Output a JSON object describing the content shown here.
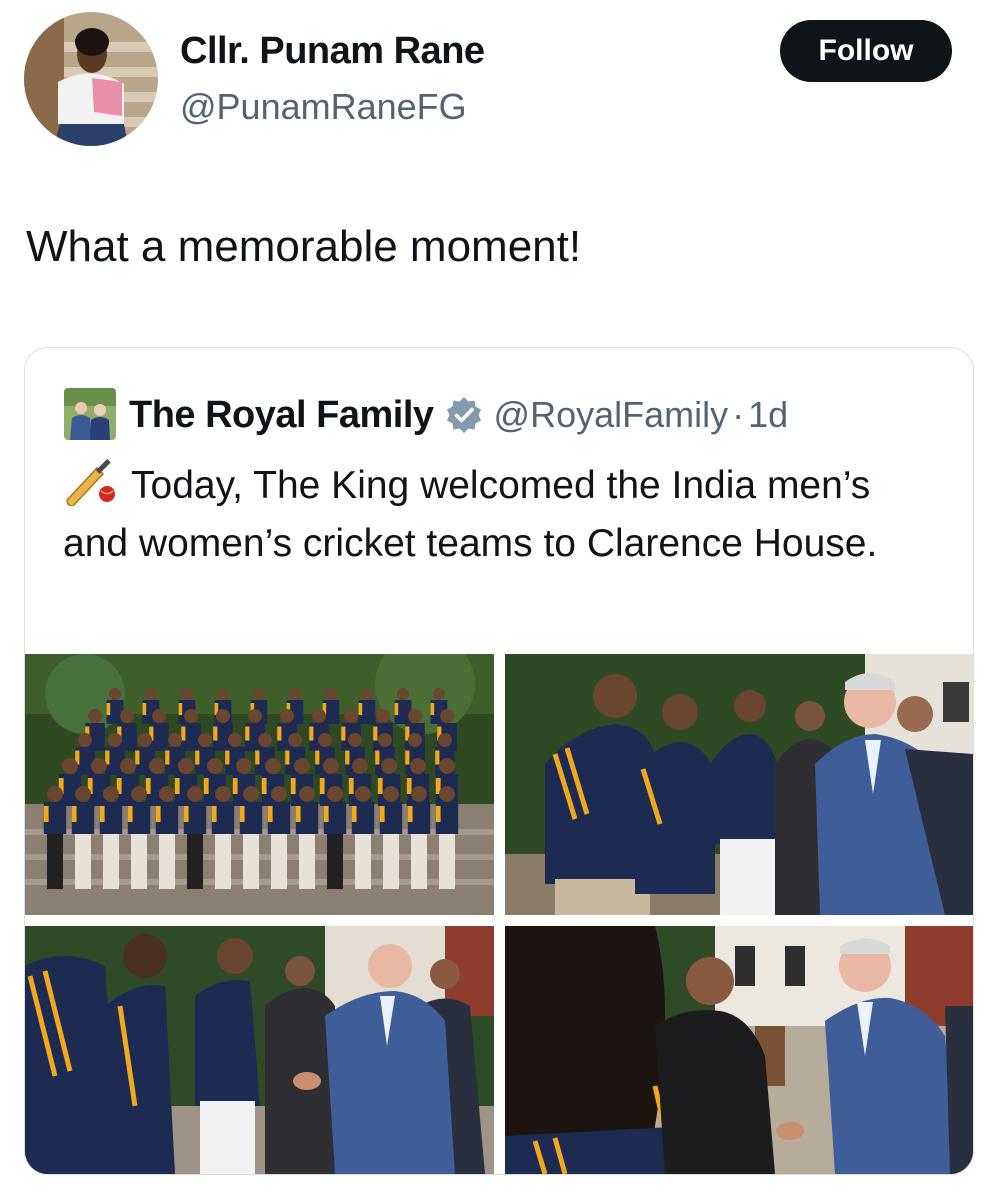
{
  "author": {
    "name": "Cllr. Punam Rane",
    "handle": "@PunamRaneFG",
    "follow_label": "Follow"
  },
  "tweet": {
    "text": "What a memorable moment!"
  },
  "quoted": {
    "name": "The Royal Family",
    "handle": "@RoyalFamily",
    "separator": "·",
    "time": "1d",
    "text": "Today, The King welcomed the India men’s and women’s cricket teams to Clarence House.",
    "emoji": "cricket-bat-icon"
  },
  "colors": {
    "follow_bg": "#0f1419",
    "secondary_text": "#536471",
    "verified_badge": "#829aab",
    "jersey_navy": "#1d2a52",
    "jersey_stripe": "#f0a81c"
  }
}
